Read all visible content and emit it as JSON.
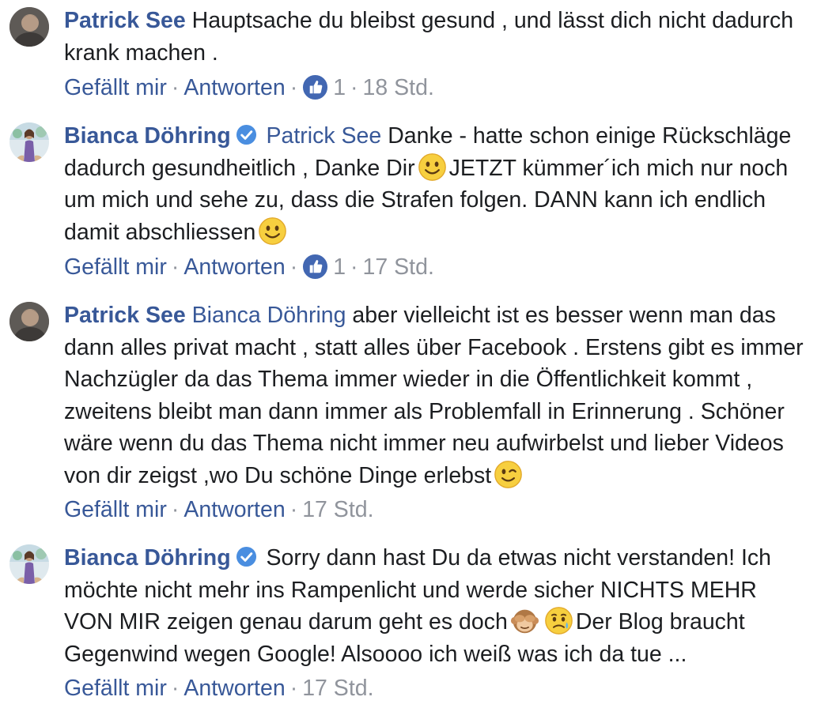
{
  "comments": [
    {
      "author": "Patrick See",
      "text": "Hauptsache du bleibst gesund , und lässt dich nicht dadurch krank machen .",
      "actions": {
        "like": "Gefällt mir",
        "reply": "Antworten",
        "reactions": "1",
        "time": "18 Std."
      }
    },
    {
      "author": "Bianca Döhring",
      "mention": "Patrick See",
      "text_1": "Danke - hatte schon einige Rückschläge dadurch gesundheitlich , Danke Dir",
      "text_2": "JETZT kümmer´ich mich nur noch um mich und sehe zu, dass die Strafen folgen. DANN kann ich endlich damit abschliessen",
      "actions": {
        "like": "Gefällt mir",
        "reply": "Antworten",
        "reactions": "1",
        "time": "17 Std."
      }
    },
    {
      "author": "Patrick See",
      "mention": "Bianca Döhring",
      "text": "aber vielleicht ist es besser wenn man das dann alles privat macht , statt alles über Facebook . Erstens gibt es immer Nachzügler da das Thema immer wieder in die Öffentlichkeit kommt , zweitens bleibt man dann immer als Problemfall in Erinnerung . Schöner wäre wenn du das Thema nicht immer neu aufwirbelst und lieber Videos von dir zeigst ,wo Du schöne Dinge erlebst",
      "actions": {
        "like": "Gefällt mir",
        "reply": "Antworten",
        "time": "17 Std."
      }
    },
    {
      "author": "Bianca Döhring",
      "text_1": "Sorry dann hast Du da etwas nicht verstanden! Ich möchte nicht mehr ins Rampenlicht und werde sicher NICHTS MEHR VON MIR zeigen genau darum geht es doch",
      "text_2": "Der Blog braucht Gegenwind wegen Google! Alsoooo ich weiß was ich da tue ...",
      "actions": {
        "like": "Gefällt mir",
        "reply": "Antworten",
        "time": "17 Std."
      }
    }
  ],
  "icons": {
    "verified": "verified-badge-icon",
    "like": "thumbs-up-icon",
    "smile": "smiling-face-emoji",
    "wink": "winking-face-emoji",
    "monkey": "see-no-evil-monkey-emoji",
    "sad": "sad-sweat-face-emoji"
  },
  "colors": {
    "link": "#385898",
    "meta": "#90949c",
    "like_badge": "#4267b2",
    "text": "#1c1e21"
  }
}
